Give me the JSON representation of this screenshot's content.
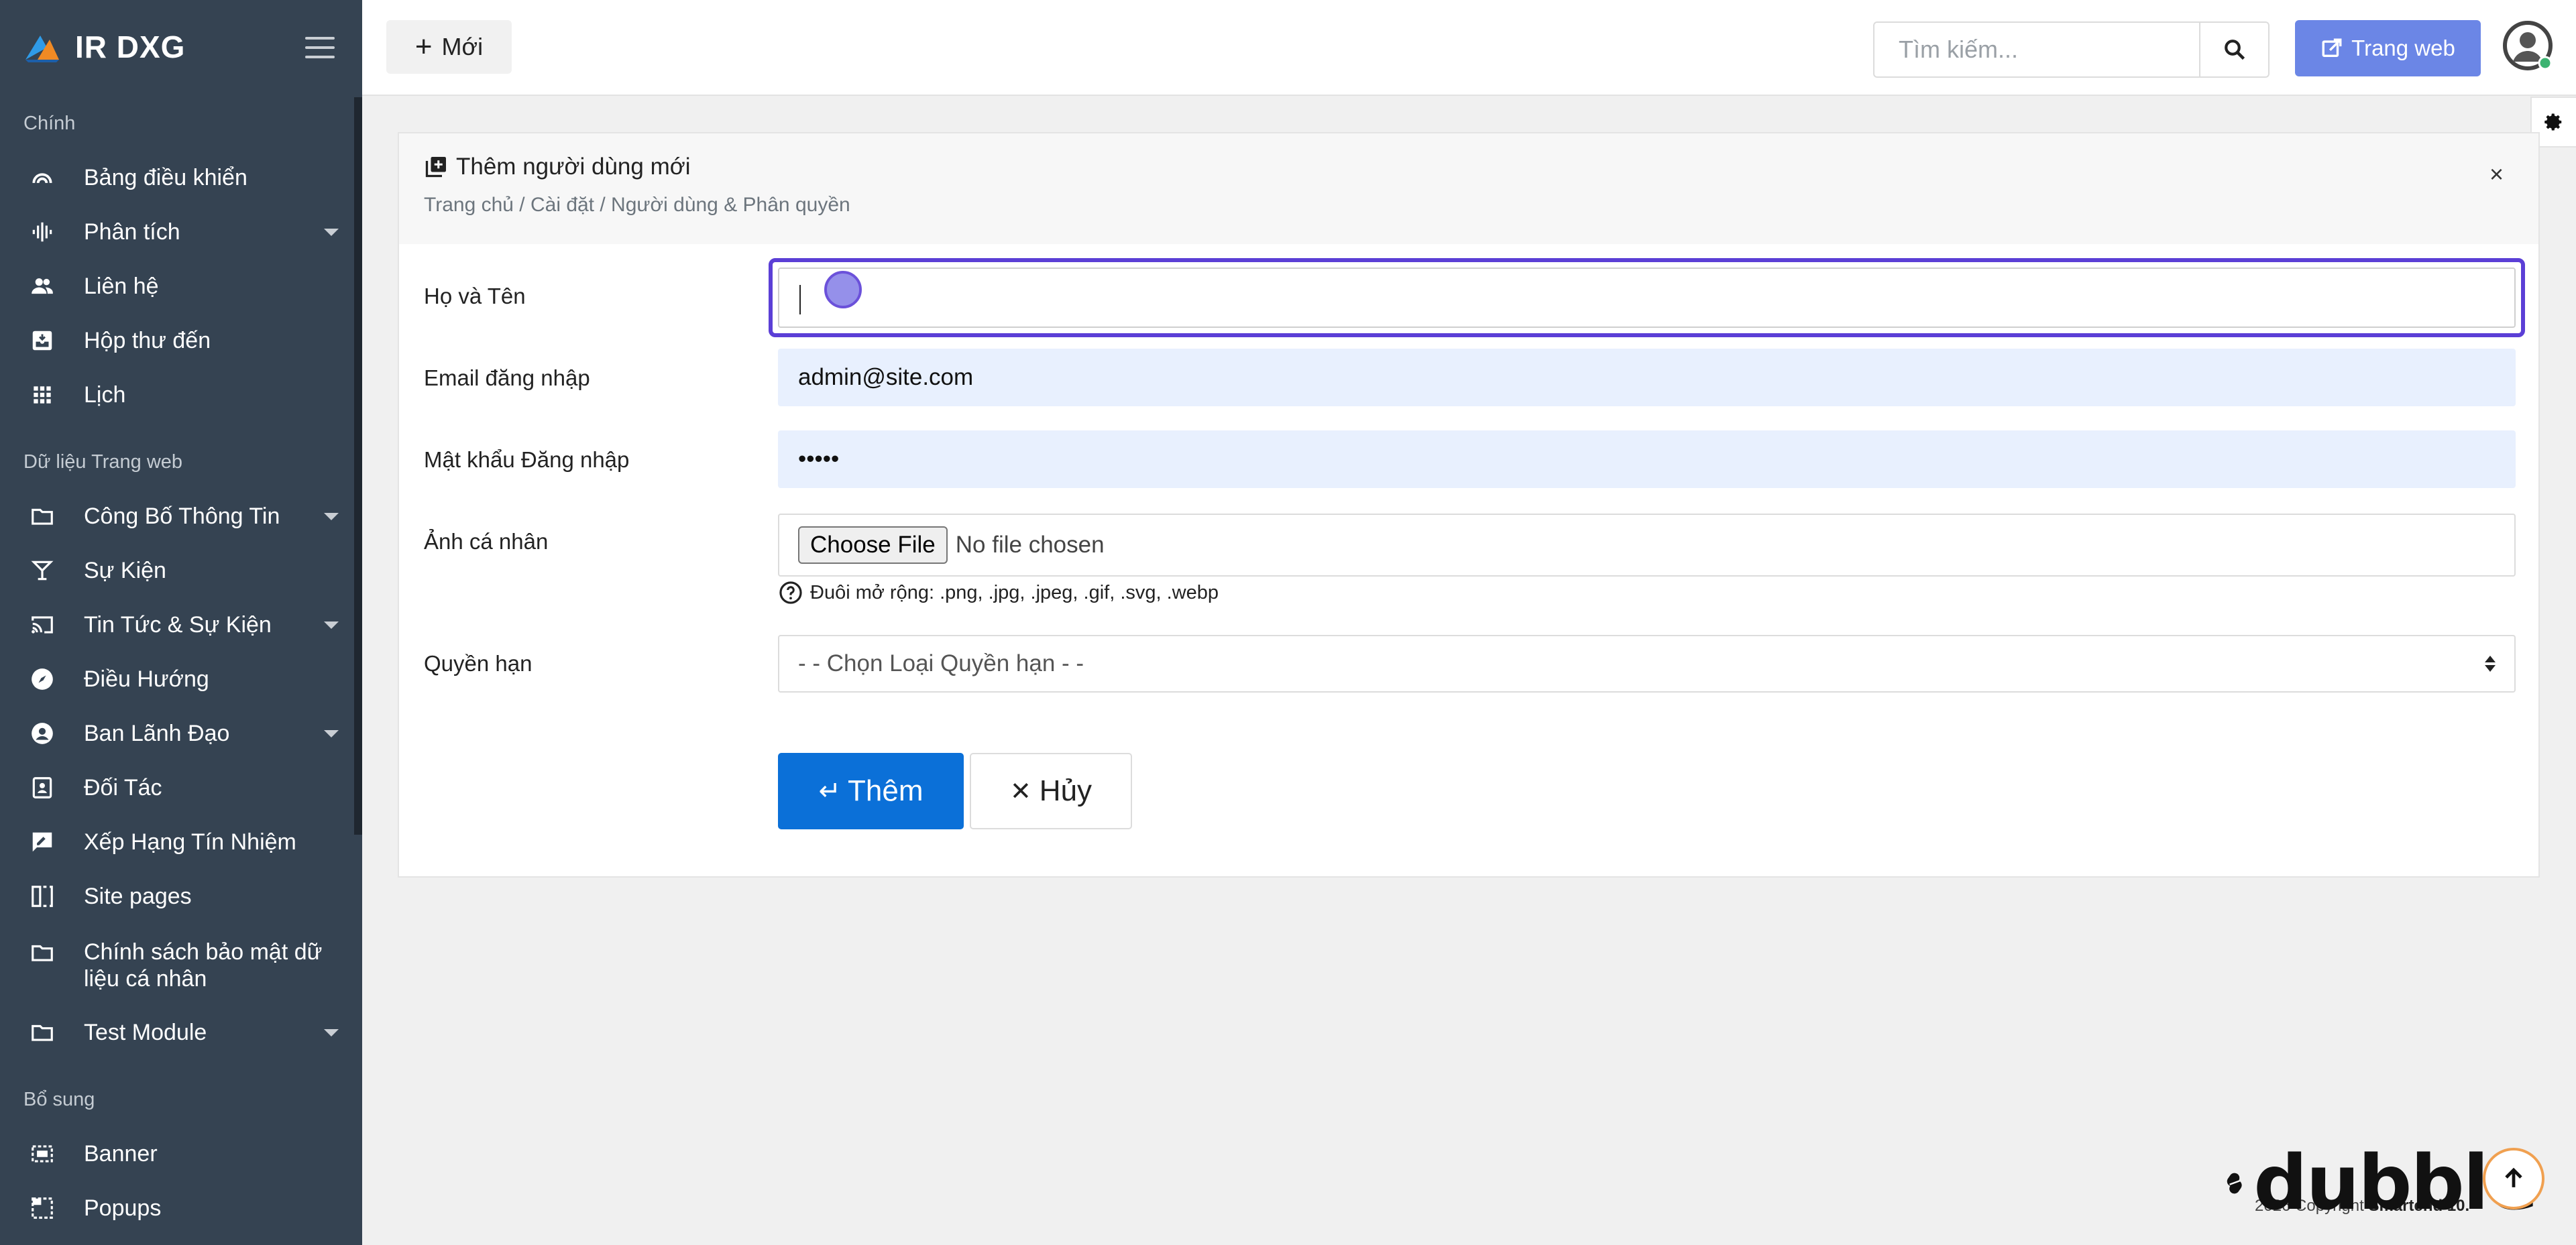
{
  "brand": {
    "name": "IR DXG"
  },
  "sidebar": {
    "sections": [
      {
        "label": "Chính"
      },
      {
        "label": "Dữ liệu Trang web"
      },
      {
        "label": "Bổ sung"
      }
    ],
    "items": [
      {
        "label": "Bảng điều khiển",
        "icon": "dashboard-icon",
        "has_children": false
      },
      {
        "label": "Phân tích",
        "icon": "analytics-icon",
        "has_children": true
      },
      {
        "label": "Liên hệ",
        "icon": "contacts-icon",
        "has_children": false
      },
      {
        "label": "Hộp thư đến",
        "icon": "inbox-icon",
        "has_children": false
      },
      {
        "label": "Lịch",
        "icon": "calendar-grid-icon",
        "has_children": false
      },
      {
        "label": "Công Bố Thông Tin",
        "icon": "folder-icon",
        "has_children": true
      },
      {
        "label": "Sự Kiện",
        "icon": "cocktail-icon",
        "has_children": false
      },
      {
        "label": "Tin Tức & Sự Kiện",
        "icon": "cast-icon",
        "has_children": true
      },
      {
        "label": "Điều Hướng",
        "icon": "compass-icon",
        "has_children": false
      },
      {
        "label": "Ban Lãnh Đạo",
        "icon": "person-circle-icon",
        "has_children": true
      },
      {
        "label": "Đối Tác",
        "icon": "contact-card-icon",
        "has_children": false
      },
      {
        "label": "Xếp Hạng Tín Nhiệm",
        "icon": "rate-review-icon",
        "has_children": false
      },
      {
        "label": "Site pages",
        "icon": "pages-icon",
        "has_children": false
      },
      {
        "label": "Chính sách bảo mật dữ liệu cá nhân",
        "icon": "folder-icon",
        "has_children": false
      },
      {
        "label": "Test Module",
        "icon": "folder-icon",
        "has_children": true
      },
      {
        "label": "Banner",
        "icon": "banner-icon",
        "has_children": false
      },
      {
        "label": "Popups",
        "icon": "popup-icon",
        "has_children": false
      }
    ]
  },
  "topbar": {
    "new_label": "Mới",
    "search_placeholder": "Tìm kiếm...",
    "website_label": "Trang web"
  },
  "panel": {
    "title": "Thêm người dùng mới",
    "breadcrumb": "Trang chủ / Cài đặt / Người dùng & Phân quyền",
    "close": "×"
  },
  "form": {
    "fullname_label": "Họ và Tên",
    "fullname_value": "",
    "email_label": "Email đăng nhập",
    "email_value": "admin@site.com",
    "password_label": "Mật khẩu Đăng nhập",
    "password_value": "•••••",
    "avatar_label": "Ảnh cá nhân",
    "choose_file_label": "Choose File",
    "no_file_text": "No file chosen",
    "hint": "Đuôi mở rộng: .png, .jpg, .jpeg, .gif, .svg, .webp",
    "role_label": "Quyền hạn",
    "role_selected": "- - Chọn Loại Quyền hạn - -",
    "submit_label": "Thêm",
    "cancel_label": "Hủy"
  },
  "footer": {
    "copyright_prefix": "2026 Copyright ",
    "copyright_brand": "Smartend 10."
  },
  "watermark": {
    "text": "dubble"
  },
  "colors": {
    "sidebar_bg": "#354352",
    "primary": "#0b70d8",
    "website_button": "#6b86e6",
    "focus_ring": "#5b3fd6",
    "autofill_bg": "#e8f0fe"
  }
}
